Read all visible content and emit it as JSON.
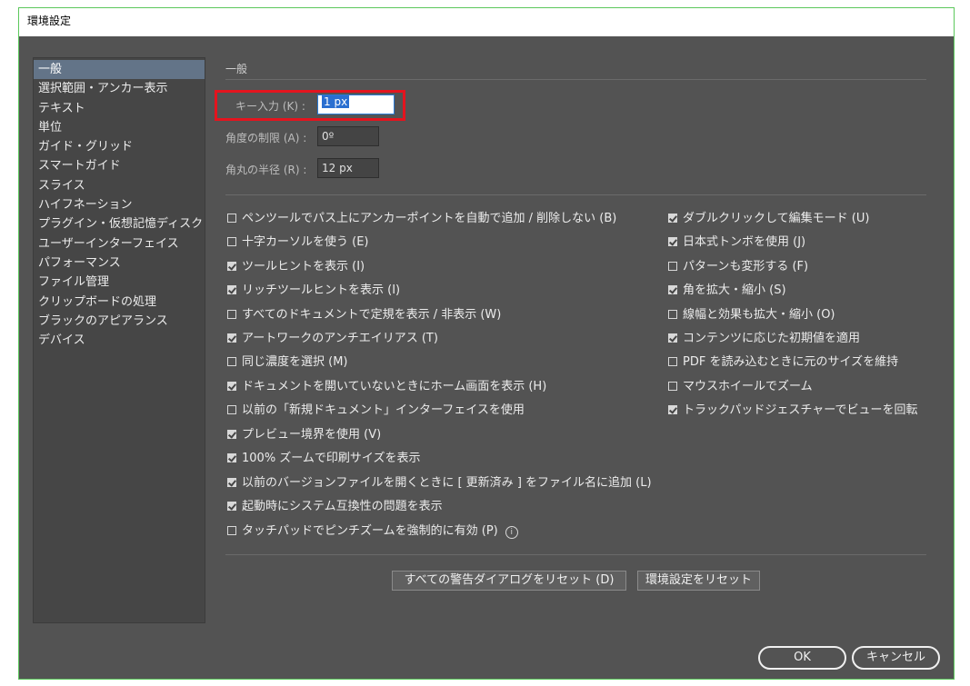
{
  "window": {
    "title": "環境設定"
  },
  "sidebar": {
    "items": [
      "一般",
      "選択範囲・アンカー表示",
      "テキスト",
      "単位",
      "ガイド・グリッド",
      "スマートガイド",
      "スライス",
      "ハイフネーション",
      "プラグイン・仮想記憶ディスク",
      "ユーザーインターフェイス",
      "パフォーマンス",
      "ファイル管理",
      "クリップボードの処理",
      "ブラックのアピアランス",
      "デバイス"
    ],
    "selected": "一般"
  },
  "section": {
    "title": "一般"
  },
  "fields": {
    "keyboard_increment": {
      "label": "キー入力 (K) :",
      "value": "1 px"
    },
    "constrain_angle": {
      "label": "角度の制限 (A) :",
      "value": "0º"
    },
    "corner_radius": {
      "label": "角丸の半径 (R) :",
      "value": "12 px"
    }
  },
  "options_left": [
    {
      "label": "ペンツールでパス上にアンカーポイントを自動で追加 / 削除しない (B)",
      "checked": false
    },
    {
      "label": "十字カーソルを使う (E)",
      "checked": false
    },
    {
      "label": "ツールヒントを表示 (I)",
      "checked": true
    },
    {
      "label": "リッチツールヒントを表示 (I)",
      "checked": true
    },
    {
      "label": "すべてのドキュメントで定規を表示 / 非表示 (W)",
      "checked": false
    },
    {
      "label": "アートワークのアンチエイリアス (T)",
      "checked": true
    },
    {
      "label": "同じ濃度を選択 (M)",
      "checked": false
    },
    {
      "label": "ドキュメントを開いていないときにホーム画面を表示 (H)",
      "checked": true
    },
    {
      "label": "以前の「新規ドキュメント」インターフェイスを使用",
      "checked": false
    },
    {
      "label": "プレビュー境界を使用 (V)",
      "checked": true
    },
    {
      "label": "100% ズームで印刷サイズを表示",
      "checked": true
    },
    {
      "label": "以前のバージョンファイルを開くときに [ 更新済み ] をファイル名に追加 (L)",
      "checked": true
    },
    {
      "label": "起動時にシステム互換性の問題を表示",
      "checked": true
    },
    {
      "label": "タッチパッドでピンチズームを強制的に有効 (P)",
      "checked": false
    }
  ],
  "options_right": [
    {
      "label": "ダブルクリックして編集モード (U)",
      "checked": true
    },
    {
      "label": "日本式トンボを使用 (J)",
      "checked": true
    },
    {
      "label": "パターンも変形する (F)",
      "checked": false
    },
    {
      "label": "角を拡大・縮小 (S)",
      "checked": true
    },
    {
      "label": "線幅と効果も拡大・縮小 (O)",
      "checked": false
    },
    {
      "label": "コンテンツに応じた初期値を適用",
      "checked": true
    },
    {
      "label": "PDF を読み込むときに元のサイズを維持",
      "checked": false
    },
    {
      "label": "マウスホイールでズーム",
      "checked": false
    },
    {
      "label": "トラックパッドジェスチャーでビューを回転",
      "checked": true
    }
  ],
  "info_icon": "i",
  "buttons": {
    "reset_warnings": "すべての警告ダイアログをリセット (D)",
    "reset_preferences": "環境設定をリセット",
    "ok": "OK",
    "cancel": "キャンセル"
  },
  "colors": {
    "panel_bg": "#535353",
    "sidebar_bg": "#464646",
    "selected_item": "#637488",
    "highlight_box": "#e4141e"
  }
}
